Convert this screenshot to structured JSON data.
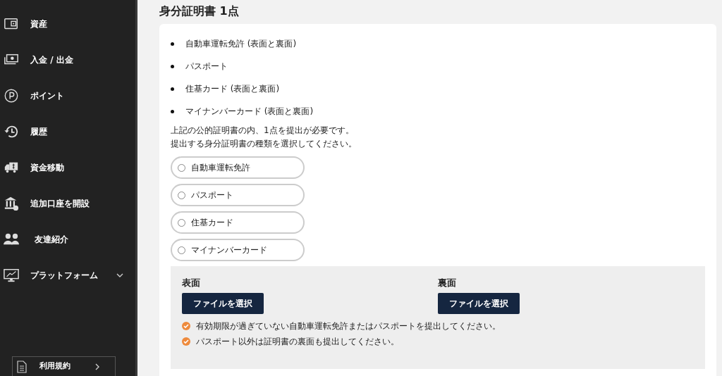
{
  "sidebar": {
    "items": [
      {
        "label": "資産",
        "kind": "link"
      },
      {
        "label": "入金 / 出金",
        "kind": "link"
      },
      {
        "label": "ポイント",
        "kind": "link"
      },
      {
        "label": "履歴",
        "kind": "link"
      },
      {
        "label": "資金移動",
        "kind": "link"
      },
      {
        "label": "追加口座を開設",
        "kind": "link"
      },
      {
        "label": "友達紹介",
        "kind": "link"
      },
      {
        "label": "プラットフォーム",
        "kind": "expandable",
        "expanded": false
      }
    ],
    "footer_button": "利用規約"
  },
  "section": {
    "title": "身分証明書 1点",
    "documents": [
      "自動車運転免許 (表面と裏面)",
      "パスポート",
      "住基カード (表面と裏面)",
      "マイナンバーカード (表面と裏面)"
    ],
    "instructions": [
      "上記の公的証明書の内、1点を提出が必要です。",
      "提出する身分証明書の種類を選択してください。"
    ],
    "options": [
      {
        "label": "自動車運転免許",
        "selected": false
      },
      {
        "label": "パスポート",
        "selected": false
      },
      {
        "label": "住基カード",
        "selected": false
      },
      {
        "label": "マイナンバーカード",
        "selected": false
      }
    ],
    "upload": {
      "sides": [
        {
          "label": "表面",
          "button": "ファイルを選択"
        },
        {
          "label": "裏面",
          "button": "ファイルを選択"
        }
      ],
      "notes": [
        "有効期限が過ぎていない自動車運転免許またはパスポートを提出してください。",
        "パスポート以外は証明書の裏面も提出してください。"
      ]
    }
  }
}
